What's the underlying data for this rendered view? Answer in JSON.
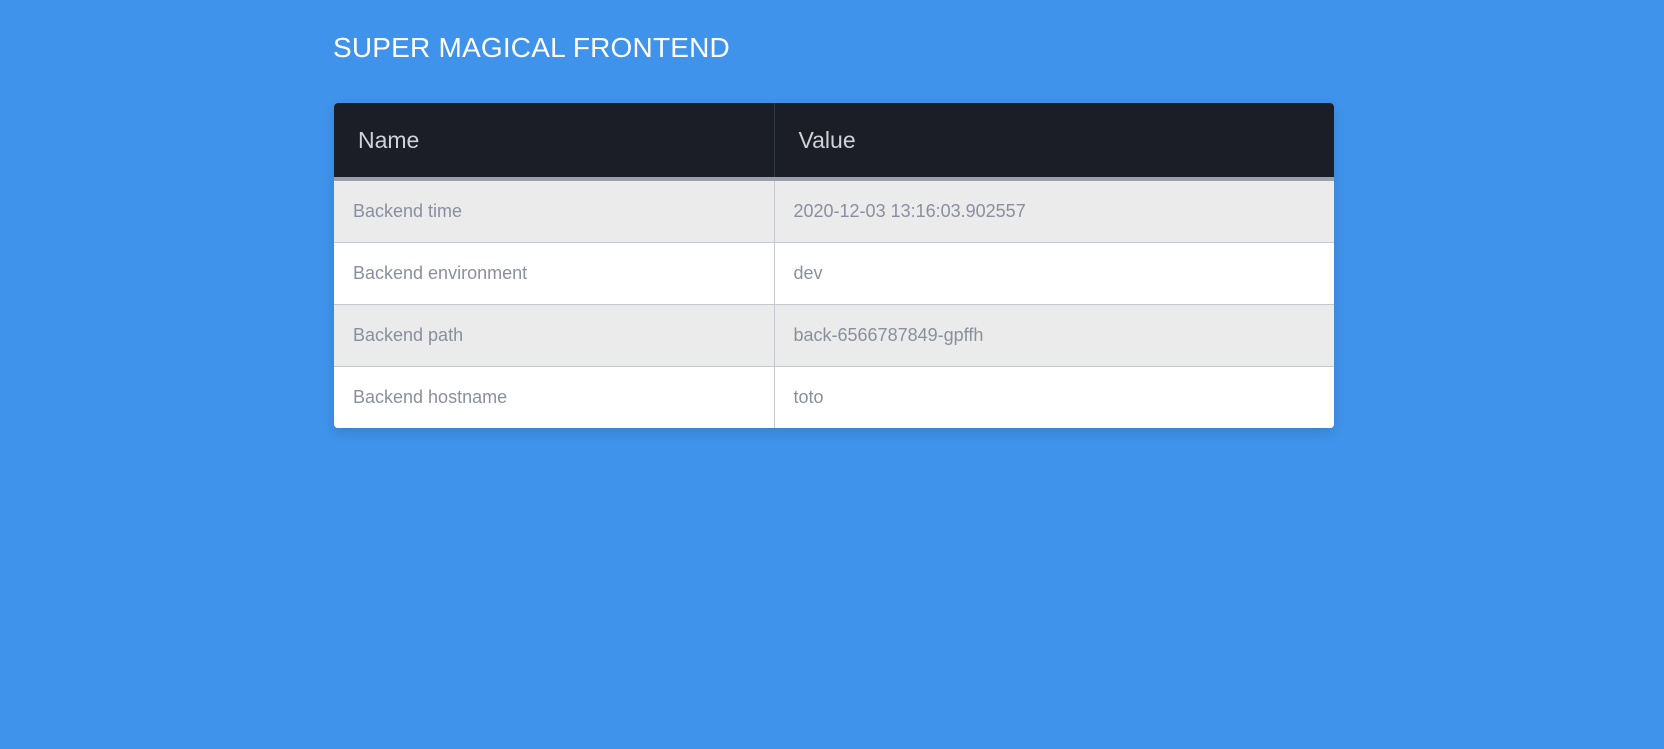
{
  "page": {
    "title": "SUPER MAGICAL FRONTEND"
  },
  "table": {
    "columns": [
      "Name",
      "Value"
    ],
    "rows": [
      {
        "name": "Backend time",
        "value": "2020-12-03 13:16:03.902557"
      },
      {
        "name": "Backend environment",
        "value": "dev"
      },
      {
        "name": "Backend path",
        "value": "back-6566787849-gpffh"
      },
      {
        "name": "Backend hostname",
        "value": "toto"
      }
    ]
  },
  "colors": {
    "background": "#3f93eb",
    "header_background": "#1c1e27",
    "row_alt_background": "#ebebeb",
    "text": "#8a8f9f"
  }
}
